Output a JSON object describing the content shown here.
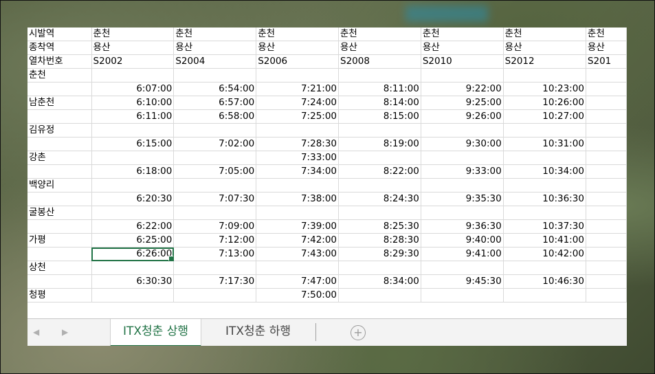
{
  "spreadsheet": {
    "columns": [
      {
        "origin": "춘천",
        "dest": "용산",
        "train": "S2002"
      },
      {
        "origin": "춘천",
        "dest": "용산",
        "train": "S2004"
      },
      {
        "origin": "춘천",
        "dest": "용산",
        "train": "S2006"
      },
      {
        "origin": "춘천",
        "dest": "용산",
        "train": "S2008"
      },
      {
        "origin": "춘천",
        "dest": "용산",
        "train": "S2010"
      },
      {
        "origin": "춘천",
        "dest": "용산",
        "train": "S2012"
      },
      {
        "origin": "춘천",
        "dest": "용산",
        "train": "S201"
      }
    ],
    "header_labels": {
      "origin": "시발역",
      "dest": "종착역",
      "train": "열차번호"
    },
    "rows": [
      {
        "label": "시발역",
        "type": "header",
        "key": "origin"
      },
      {
        "label": "종착역",
        "type": "header",
        "key": "dest"
      },
      {
        "label": "열차번호",
        "type": "header",
        "key": "train"
      },
      {
        "label": "춘천",
        "values": [
          "",
          "",
          "",
          "",
          "",
          "",
          ""
        ]
      },
      {
        "label": "",
        "values": [
          "6:07:00",
          "6:54:00",
          "7:21:00",
          "8:11:00",
          "9:22:00",
          "10:23:00",
          ""
        ]
      },
      {
        "label": "남춘천",
        "values": [
          "6:10:00",
          "6:57:00",
          "7:24:00",
          "8:14:00",
          "9:25:00",
          "10:26:00",
          ""
        ]
      },
      {
        "label": "",
        "values": [
          "6:11:00",
          "6:58:00",
          "7:25:00",
          "8:15:00",
          "9:26:00",
          "10:27:00",
          ""
        ]
      },
      {
        "label": "김유정",
        "values": [
          "",
          "",
          "",
          "",
          "",
          "",
          ""
        ]
      },
      {
        "label": "",
        "values": [
          "6:15:00",
          "7:02:00",
          "7:28:30",
          "8:19:00",
          "9:30:00",
          "10:31:00",
          ""
        ]
      },
      {
        "label": "강촌",
        "values": [
          "",
          "",
          "7:33:00",
          "",
          "",
          "",
          ""
        ]
      },
      {
        "label": "",
        "values": [
          "6:18:00",
          "7:05:00",
          "7:34:00",
          "8:22:00",
          "9:33:00",
          "10:34:00",
          ""
        ]
      },
      {
        "label": "백양리",
        "values": [
          "",
          "",
          "",
          "",
          "",
          "",
          ""
        ]
      },
      {
        "label": "",
        "values": [
          "6:20:30",
          "7:07:30",
          "7:38:00",
          "8:24:30",
          "9:35:30",
          "10:36:30",
          ""
        ]
      },
      {
        "label": "굴봉산",
        "values": [
          "",
          "",
          "",
          "",
          "",
          "",
          ""
        ]
      },
      {
        "label": "",
        "values": [
          "6:22:00",
          "7:09:00",
          "7:39:00",
          "8:25:30",
          "9:36:30",
          "10:37:30",
          ""
        ]
      },
      {
        "label": "가평",
        "values": [
          "6:25:00",
          "7:12:00",
          "7:42:00",
          "8:28:30",
          "9:40:00",
          "10:41:00",
          ""
        ]
      },
      {
        "label": "",
        "values": [
          "6:26:00",
          "7:13:00",
          "7:43:00",
          "8:29:30",
          "9:41:00",
          "10:42:00",
          ""
        ],
        "selected_col": 0
      },
      {
        "label": "상천",
        "values": [
          "",
          "",
          "",
          "",
          "",
          "",
          ""
        ]
      },
      {
        "label": "",
        "values": [
          "6:30:30",
          "7:17:30",
          "7:47:00",
          "8:34:00",
          "9:45:30",
          "10:46:30",
          ""
        ]
      },
      {
        "label": "청평",
        "values": [
          "",
          "",
          "7:50:00",
          "",
          "",
          "",
          ""
        ]
      }
    ]
  },
  "sheet_tabs": {
    "nav_prev": "◀",
    "nav_next": "▶",
    "tabs": [
      {
        "label": "ITX청춘 상행",
        "active": true
      },
      {
        "label": "ITX청춘 하행",
        "active": false
      }
    ],
    "add_label": "+"
  },
  "colors": {
    "accent": "#217346",
    "gridline": "#d9d9d9"
  }
}
